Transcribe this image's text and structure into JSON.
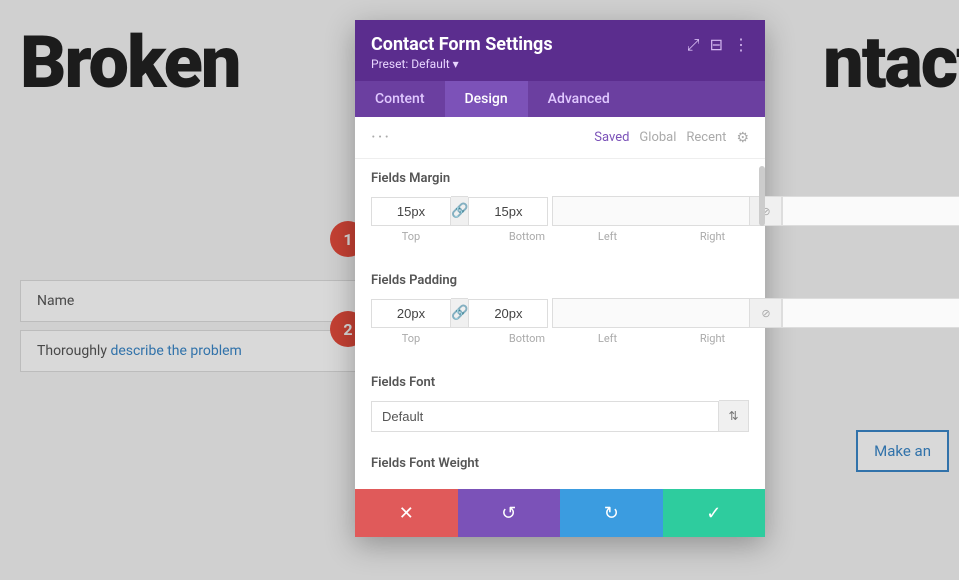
{
  "background": {
    "title_left": "Broken",
    "title_right": "ntact",
    "form": {
      "name_placeholder": "Name",
      "message_placeholder_text": "Thoroughly describe the problem",
      "message_link_word": "describe"
    },
    "make_btn": "Make an"
  },
  "modal": {
    "title": "Contact Form Settings",
    "preset_label": "Preset:",
    "preset_value": "Default",
    "preset_arrow": "▾",
    "tabs": [
      {
        "label": "Content",
        "active": false
      },
      {
        "label": "Design",
        "active": true
      },
      {
        "label": "Advanced",
        "active": false
      }
    ],
    "sub_header": {
      "dots": "···",
      "links": [
        "Saved",
        "Global",
        "Recent"
      ],
      "active_link": "Saved",
      "gear_icon": "⚙"
    },
    "sections": [
      {
        "title": "Fields Margin",
        "top_value": "15px",
        "bottom_value": "15px",
        "left_placeholder": "",
        "right_placeholder": "",
        "top_label": "Top",
        "bottom_label": "Bottom",
        "left_label": "Left",
        "right_label": "Right"
      },
      {
        "title": "Fields Padding",
        "top_value": "20px",
        "bottom_value": "20px",
        "left_placeholder": "",
        "right_placeholder": "",
        "top_label": "Top",
        "bottom_label": "Bottom",
        "left_label": "Left",
        "right_label": "Right"
      },
      {
        "title": "Fields Font",
        "font_value": "Default",
        "font_arrow": "⇅"
      },
      {
        "title": "Fields Font Weight"
      }
    ],
    "icons": {
      "expand": "⤢",
      "columns": "⊟",
      "more": "⋮",
      "link": "🔗",
      "slash": "⊘"
    },
    "footer": {
      "cancel_icon": "✕",
      "undo_icon": "↺",
      "redo_icon": "↻",
      "save_icon": "✓"
    }
  },
  "badges": [
    {
      "number": "1"
    },
    {
      "number": "2"
    }
  ]
}
